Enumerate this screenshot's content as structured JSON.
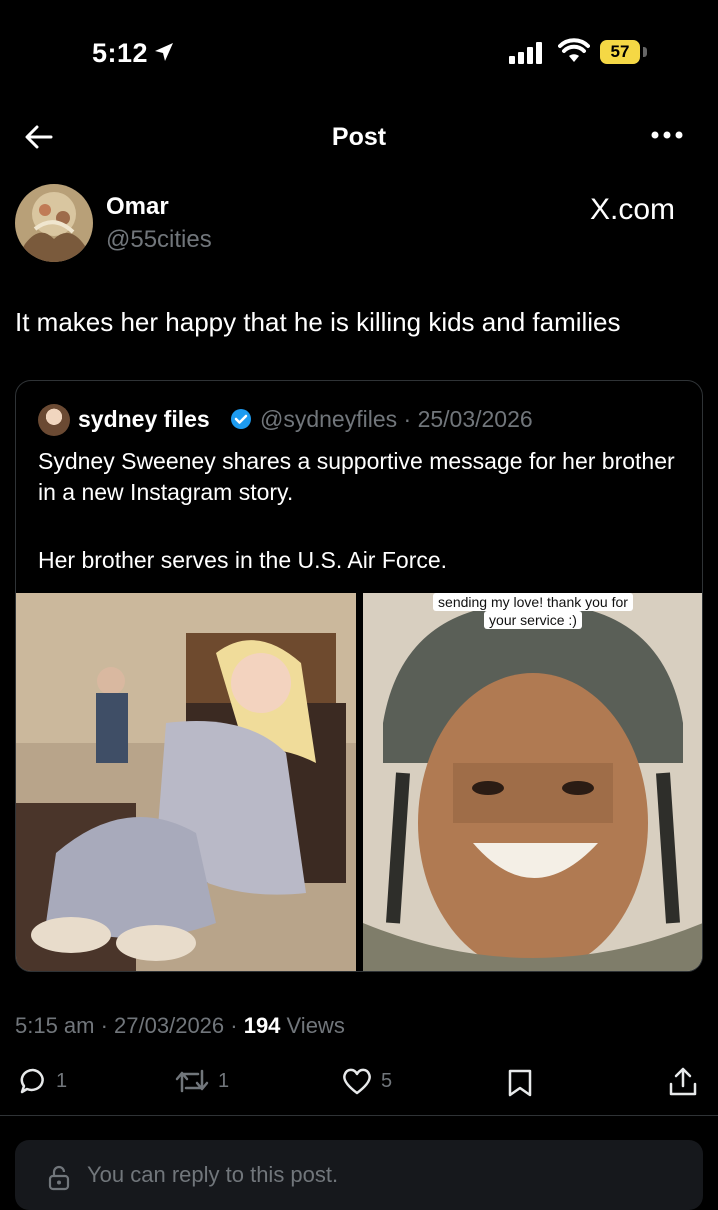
{
  "status_bar": {
    "time": "5:12",
    "battery": "57"
  },
  "nav": {
    "title": "Post"
  },
  "author": {
    "name": "Omar",
    "handle": "@55cities",
    "site_label": "X.com"
  },
  "post": {
    "text": "It makes her happy that he is killing kids and families"
  },
  "quote": {
    "name": "sydney files",
    "handle_date": "@sydneyfiles · 25/03/2026",
    "text": "Sydney Sweeney shares a supportive message for her brother in a new Instagram story.",
    "text2": "Her brother serves in the U.S. Air Force.",
    "image_caption_line1": "sending my love! thank you for",
    "image_caption_line2": "your service :)"
  },
  "meta": {
    "time_date": "5:15 am · 27/03/2026 · ",
    "views_count": "194",
    "views_label": " Views"
  },
  "actions": {
    "replies": "1",
    "reposts": "1",
    "likes": "5"
  },
  "reply": {
    "placeholder": "You can reply to this post."
  },
  "colors": {
    "background": "#000000",
    "text": "#e7e9ea",
    "secondary": "#71767b",
    "verified": "#1d9bf0",
    "battery": "#f5d845"
  }
}
